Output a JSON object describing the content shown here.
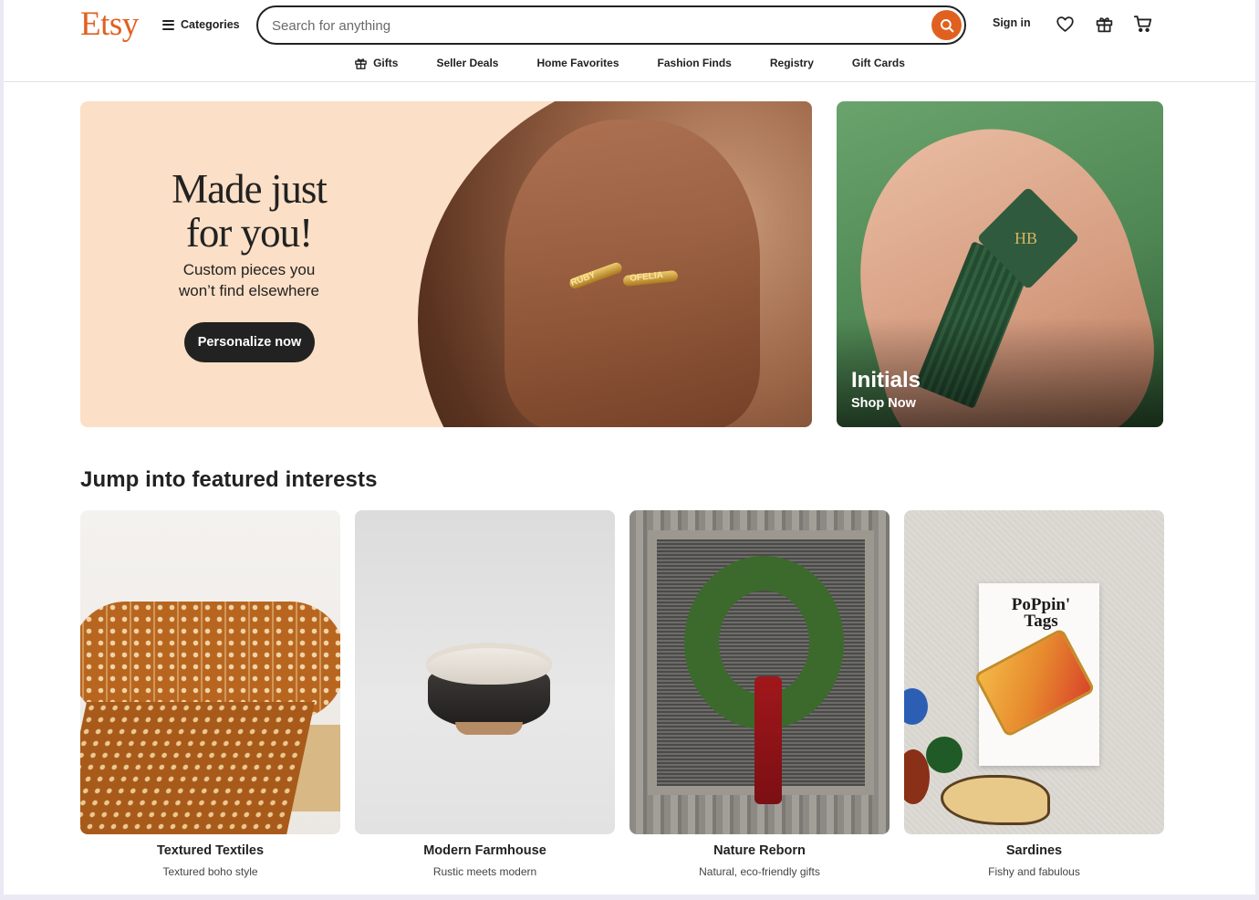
{
  "header": {
    "logo": "Etsy",
    "categories_label": "Categories",
    "search_placeholder": "Search for anything",
    "signin_label": "Sign in"
  },
  "nav": {
    "items": [
      {
        "label": "Gifts"
      },
      {
        "label": "Seller Deals"
      },
      {
        "label": "Home Favorites"
      },
      {
        "label": "Fashion Finds"
      },
      {
        "label": "Registry"
      },
      {
        "label": "Gift Cards"
      }
    ]
  },
  "hero": {
    "title_line1": "Made just",
    "title_line2": "for you!",
    "subtitle_line1": "Custom pieces you",
    "subtitle_line2": "won’t find elsewhere",
    "button_label": "Personalize now",
    "ring_text_1": "RUBY",
    "ring_text_2": "OFELIA"
  },
  "promo": {
    "title": "Initials",
    "cta": "Shop Now",
    "monogram": "HB"
  },
  "featured": {
    "heading": "Jump into featured interests",
    "cards": [
      {
        "title": "Textured Textiles",
        "subtitle": "Textured boho style"
      },
      {
        "title": "Modern Farmhouse",
        "subtitle": "Rustic meets modern"
      },
      {
        "title": "Nature Reborn",
        "subtitle": "Natural, eco-friendly gifts"
      },
      {
        "title": "Sardines",
        "subtitle": "Fishy and fabulous",
        "brand": "PoPpin' Tags"
      }
    ]
  },
  "colors": {
    "brand": "#e0611f",
    "dark": "#222222",
    "hero_bg": "#fbdfc6"
  }
}
